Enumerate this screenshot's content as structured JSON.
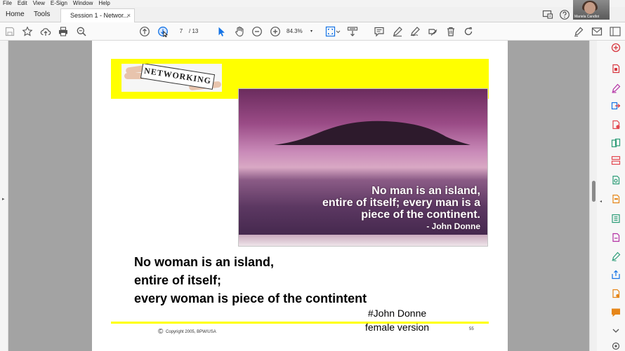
{
  "menu": [
    "File",
    "Edit",
    "View",
    "E-Sign",
    "Window",
    "Help"
  ],
  "nav": {
    "home": "Home",
    "tools": "Tools"
  },
  "document_tab": {
    "title": "Session 1 - Networ...",
    "close": "×"
  },
  "video": {
    "participant_name": "Mariela Candlot"
  },
  "toolbar": {
    "current_page": "7",
    "total_pages": "/ 13",
    "zoom": "84.3%",
    "zoom_caret": "▾"
  },
  "slide": {
    "logo_word": "NETWORKING",
    "quote_lines": [
      "No man is an island,",
      "entire of itself; every man is a",
      "piece of the continent."
    ],
    "quote_attribution": "- John Donne",
    "body_lines": [
      "No woman is an island,",
      "entire of itself;",
      "every woman is piece of the contintent"
    ],
    "signature_lines": [
      "#John Donne",
      "female version"
    ],
    "copyright_symbol": "©",
    "copyright": "Copyright 2005, BPW/USA",
    "page_number": "55"
  },
  "colors": {
    "accent": "#1473e6",
    "highlight_yellow": "#ffff00",
    "tool_colors": [
      "#d7373f",
      "#b32fa4",
      "#1473e6",
      "#e34850",
      "#2d9d78",
      "#e68619",
      "#2680eb",
      "#6d56cf"
    ]
  },
  "right_tools": [
    "create-pdf-icon",
    "edit-pdf-icon",
    "export-pdf-icon",
    "organize-pages-icon",
    "combine-files-icon",
    "scan-ocr-icon",
    "compress-pdf-icon",
    "protect-icon",
    "redact-icon",
    "fill-sign-icon",
    "share-icon",
    "stamp-icon",
    "comment-icon",
    "more-tools-icon"
  ]
}
